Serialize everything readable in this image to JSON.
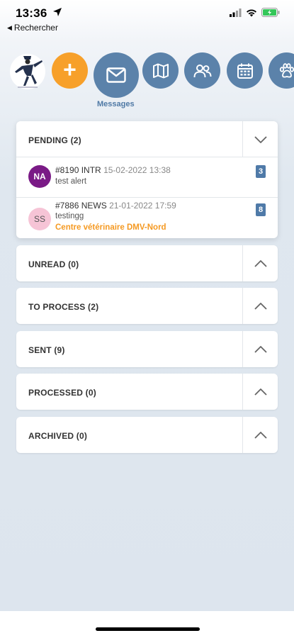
{
  "status_bar": {
    "time": "13:36"
  },
  "back_nav": {
    "label": "Rechercher"
  },
  "nav": {
    "add_symbol": "+",
    "messages_label": "Messages"
  },
  "sections": [
    {
      "title": "PENDING (2)",
      "expanded": true,
      "messages": [
        {
          "avatar": "NA",
          "number": "#8190",
          "type": "INTR",
          "date": "15-02-2022 13:38",
          "text": "test alert",
          "org": "",
          "badge": "3"
        },
        {
          "avatar": "SS",
          "number": "#7886",
          "type": "NEWS",
          "date": "21-01-2022 17:59",
          "text": "testingg",
          "org": "Centre vétérinaire DMV-Nord",
          "badge": "8"
        }
      ]
    },
    {
      "title": "UNREAD (0)",
      "expanded": false
    },
    {
      "title": "TO PROCESS (2)",
      "expanded": false
    },
    {
      "title": "SENT (9)",
      "expanded": false
    },
    {
      "title": "PROCESSED (0)",
      "expanded": false
    },
    {
      "title": "ARCHIVED (0)",
      "expanded": false
    }
  ],
  "colors": {
    "accent_orange": "#f7a02a",
    "nav_blue": "#5b82aa",
    "badge_blue": "#4f7aa8",
    "avatar_purple": "#7a1a86",
    "avatar_pink": "#f6c4d6"
  },
  "icons": [
    "location-arrow-icon",
    "signal-icon",
    "wifi-icon",
    "battery-icon",
    "add-icon",
    "envelope-icon",
    "map-icon",
    "users-icon",
    "calendar-icon",
    "paw-icon",
    "chevron-down-icon",
    "chevron-up-icon"
  ]
}
